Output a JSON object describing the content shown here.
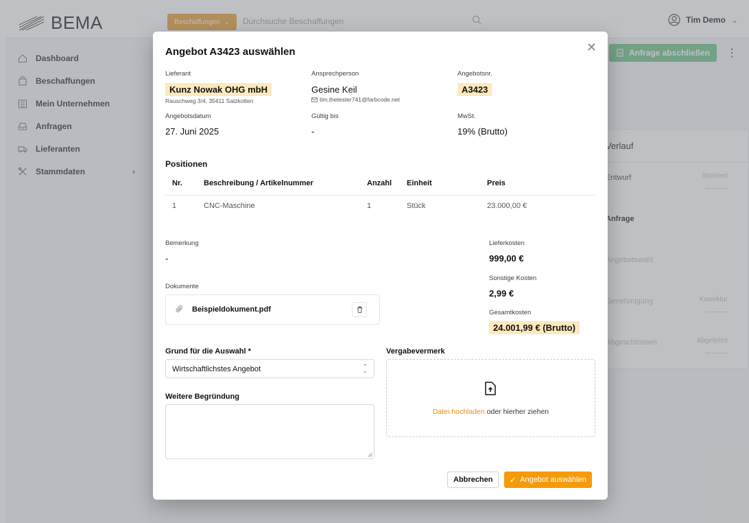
{
  "app": {
    "logo_text": "BEMA",
    "scope_label": "Beschaffungen",
    "search_placeholder": "Durchsuche Beschaffungen",
    "user_name": "Tim Demo"
  },
  "sidebar": {
    "items": [
      {
        "label": "Dashboard",
        "icon": "home-icon"
      },
      {
        "label": "Beschaffungen",
        "icon": "shopping-bag-icon"
      },
      {
        "label": "Mein Unternehmen",
        "icon": "building-icon"
      },
      {
        "label": "Anfragen",
        "icon": "inbox-icon"
      },
      {
        "label": "Lieferanten",
        "icon": "truck-icon"
      },
      {
        "label": "Stammdaten",
        "icon": "tools-icon"
      }
    ]
  },
  "background": {
    "close_request_label": "Anfrage abschließen",
    "verlauf_title": "Verlauf",
    "verlauf_rows": [
      {
        "left": "Entwurf",
        "right": "Storniert",
        "dash": "--------"
      },
      {
        "left": "Anfrage",
        "right": "",
        "dash": ""
      },
      {
        "left": "Angebotswahl",
        "right": "",
        "dash": ""
      },
      {
        "left": "Genehmigung",
        "right": "Korrektur",
        "dash": "--------"
      },
      {
        "left": "Abgeschlossen",
        "right": "Abgelehnt",
        "dash": "--------"
      }
    ]
  },
  "modal": {
    "title": "Angebot A3423 auswählen",
    "supplier_label": "Lieferant",
    "supplier_name": "Kunz Nowak OHG mbH",
    "supplier_address": "Rauschweg 3/4, 35411 Salzkotten",
    "contact_label": "Ansprechperson",
    "contact_name": "Gesine Keil",
    "contact_email": "tim.thetester741@farbcode.net",
    "offer_no_label": "Angebotsnr.",
    "offer_no": "A3423",
    "date_label": "Angebotsdatum",
    "date_value": "27. Juni 2025",
    "valid_label": "Gültig bis",
    "valid_value": "-",
    "vat_label": "MwSt.",
    "vat_value": "19% (Brutto)",
    "positions_title": "Positionen",
    "table": {
      "headers": [
        "Nr.",
        "Beschreibung / Artikelnummer",
        "Anzahl",
        "Einheit",
        "Preis"
      ],
      "rows": [
        [
          "1",
          "CNC-Maschine",
          "1",
          "Stück",
          "23.000,00 €"
        ]
      ]
    },
    "remark_label": "Bemerkung",
    "remark_value": "-",
    "delivery_label": "Lieferkosten",
    "delivery_value": "999,00 €",
    "other_label": "Sonstige Kosten",
    "other_value": "2,99 €",
    "total_label": "Gesamtkosten",
    "total_value": "24.001,99 € (Brutto)",
    "documents_label": "Dokumente",
    "document_name": "Beispieldokument.pdf",
    "reason_label": "Grund für die Auswahl *",
    "reason_value": "Wirtschaftlichstes Angebot",
    "further_label": "Weitere Begründung",
    "vergabe_label": "Vergabevermerk",
    "upload_link": "Datei hochladen",
    "upload_rest": " oder hierher ziehen",
    "cancel_label": "Abbrechen",
    "confirm_label": "Angebot auswählen"
  }
}
